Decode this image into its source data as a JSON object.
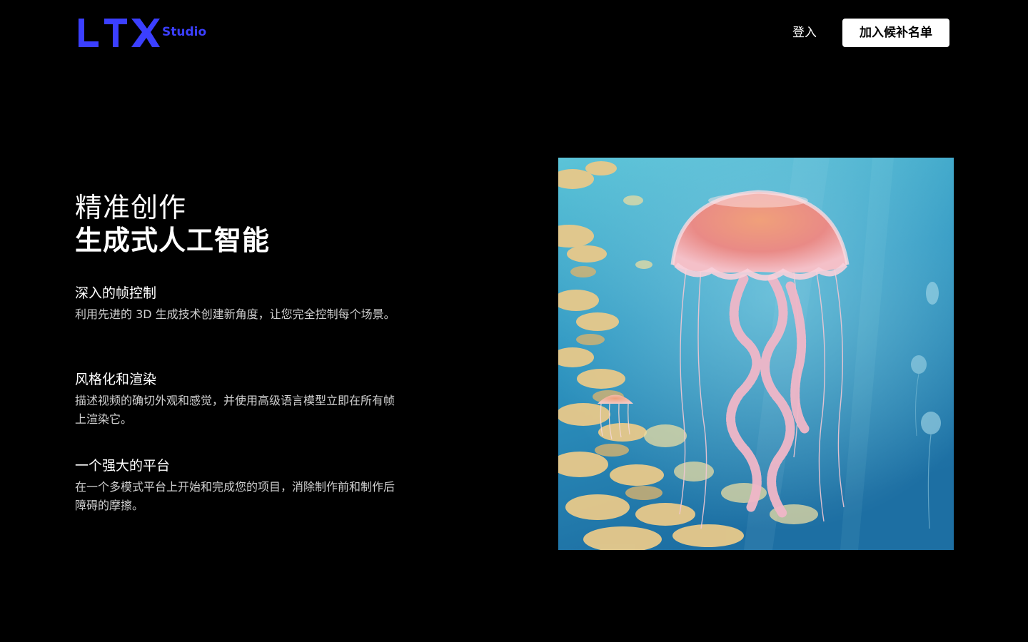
{
  "header": {
    "brand": "LTX",
    "brand_sub": "Studio",
    "login_label": "登入",
    "waitlist_label": "加入候补名单"
  },
  "hero": {
    "title_line1": "精准创作",
    "title_line2": "生成式人工智能"
  },
  "features": [
    {
      "title": "深入的帧控制",
      "description": "利用先进的 3D 生成技术创建新角度，让您完全控制每个场景。"
    },
    {
      "title": "风格化和渲染",
      "description": "描述视频的确切外观和感觉，并使用高级语言模型立即在所有帧上渲染它。"
    },
    {
      "title": "一个强大的平台",
      "description": "在一个多模式平台上开始和完成您的项目，消除制作前和制作后障碍的摩擦。"
    }
  ],
  "colors": {
    "background": "#000000",
    "brand_blue": "#3b3fff",
    "button_bg": "#ffffff",
    "text_primary": "#ffffff",
    "text_secondary": "#cfcfcf"
  },
  "icons": {
    "logo": "ltx-logo"
  }
}
